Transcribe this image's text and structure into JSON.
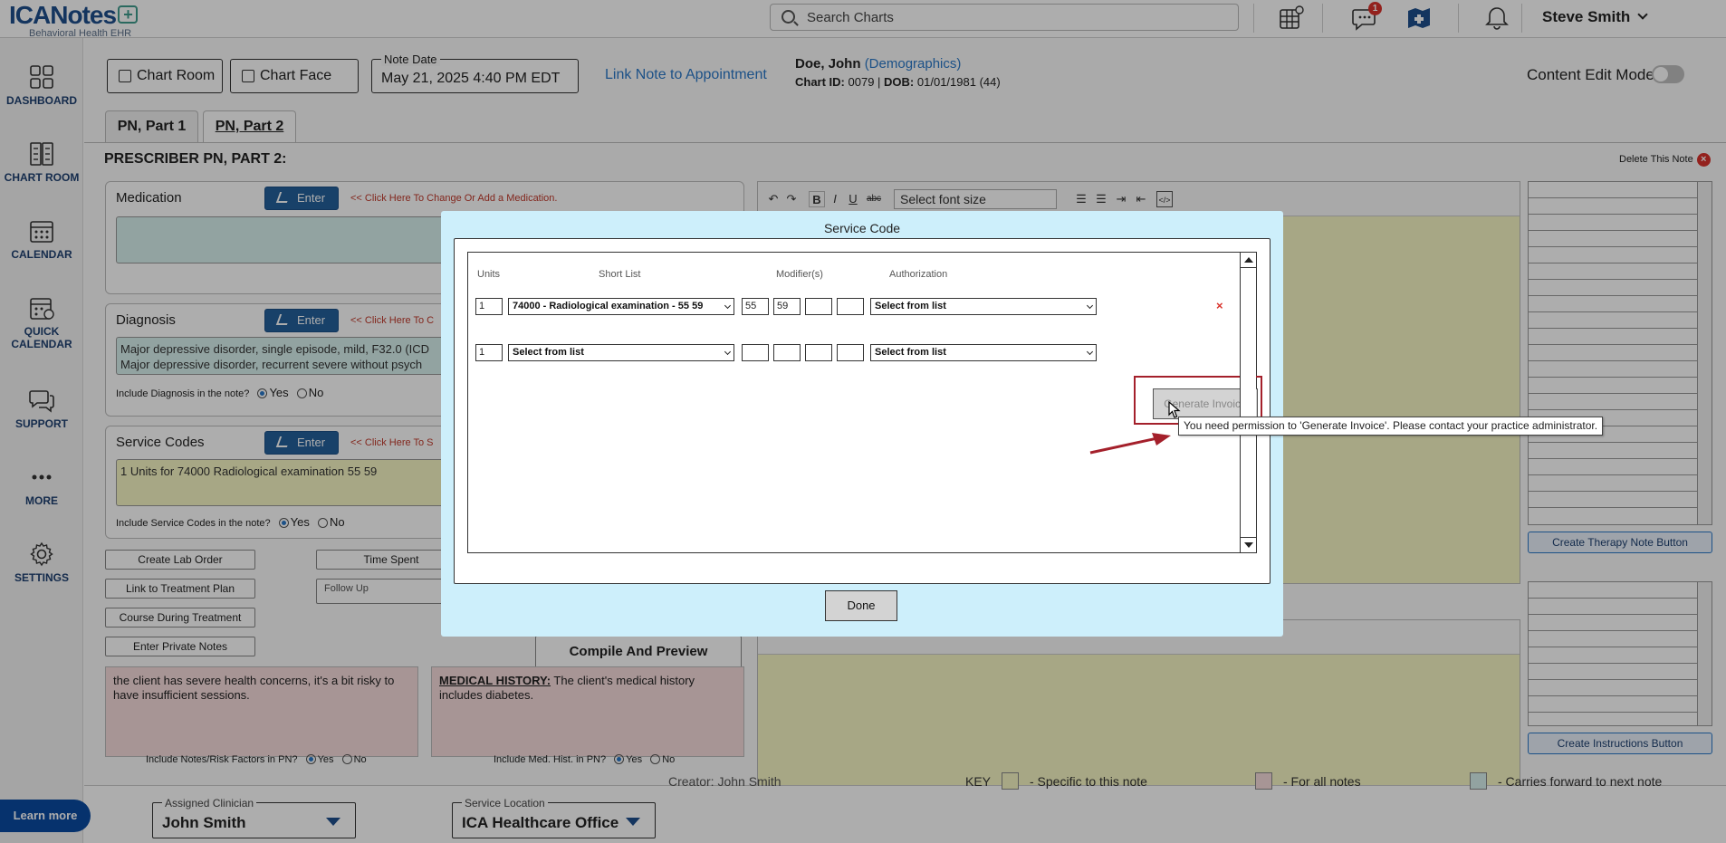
{
  "app": {
    "brand": "ICANotes",
    "tagline": "Behavioral Health EHR"
  },
  "search": {
    "placeholder": "Search Charts"
  },
  "header": {
    "messages_badge": "1",
    "user_name": "Steve Smith",
    "icons": [
      "grid-icon",
      "chat-icon",
      "map-icon",
      "bell-icon"
    ]
  },
  "sidebar": {
    "items": [
      {
        "label": "DASHBOARD",
        "icon": "dashboard-icon"
      },
      {
        "label": "CHART ROOM",
        "icon": "chart-room-icon"
      },
      {
        "label": "CALENDAR",
        "icon": "calendar-icon"
      },
      {
        "label": "QUICK CALENDAR",
        "line1": "QUICK",
        "line2": "CALENDAR",
        "icon": "quick-calendar-icon"
      },
      {
        "label": "SUPPORT",
        "icon": "support-icon"
      },
      {
        "label": "MORE",
        "icon": "more-icon"
      },
      {
        "label": "SETTINGS",
        "icon": "gear-icon"
      }
    ],
    "learn_more": "Learn more"
  },
  "toolbar": {
    "chart_room": "Chart Room",
    "chart_face": "Chart Face",
    "note_date_label": "Note Date",
    "note_date_value": "May 21, 2025 4:40 PM EDT",
    "link_appointment": "Link Note to Appointment",
    "patient_name": "Doe, John",
    "demographics": "(Demographics)",
    "chart_id_label": "Chart ID:",
    "chart_id": "0079",
    "dob_label": "DOB:",
    "dob": "01/01/1981 (44)",
    "content_edit_mode": "Content Edit Mode"
  },
  "tabs": [
    {
      "label": "PN, Part 1",
      "active": false
    },
    {
      "label": "PN, Part 2",
      "active": true
    }
  ],
  "section": {
    "title": "PRESCRIBER PN, PART 2:",
    "delete_note": "Delete This Note"
  },
  "medication": {
    "title": "Medication",
    "enter": "Enter",
    "hint": "<< Click Here To Change Or Add a Medication."
  },
  "diagnosis": {
    "title": "Diagnosis",
    "enter": "Enter",
    "hint": "<< Click Here To C",
    "line1": "Major depressive disorder, single episode, mild, F32.0 (ICD",
    "line2": "Major depressive disorder, recurrent severe without psych",
    "include_label": "Include Diagnosis in the note?",
    "yes": "Yes",
    "no": "No"
  },
  "service_codes": {
    "title": "Service Codes",
    "enter": "Enter",
    "hint": "<< Click Here To S",
    "line1": "1 Units for 74000 Radiological examination 55 59",
    "include_label": "Include Service Codes in the note?",
    "yes": "Yes",
    "no": "No"
  },
  "actions": {
    "create_lab_order": "Create Lab Order",
    "time_spent": "Time Spent",
    "link_treatment_plan": "Link to Treatment Plan",
    "follow_up": "Follow Up",
    "course_during_treatment": "Course During Treatment",
    "enter_private_notes": "Enter Private Notes",
    "compile_preview": "Compile And Preview"
  },
  "notes": {
    "risk_text": "the client has severe health concerns, it's a bit risky to have insufficient sessions.",
    "medhist_heading": "MEDICAL HISTORY:",
    "medhist_text": " The client's medical history includes diabetes.",
    "include_risk": "Include Notes/Risk Factors in PN?",
    "include_medhist": "Include Med. Hist. in PN?",
    "yes": "Yes",
    "no": "No"
  },
  "editor": {
    "font_size_placeholder": "Select font size",
    "bold": "B",
    "italic": "I",
    "underline": "U",
    "strike": "abc"
  },
  "right_panel": {
    "create_therapy": "Create Therapy Note Button",
    "create_instructions": "Create Instructions Button"
  },
  "footer": {
    "assigned_clinician_label": "Assigned Clinician",
    "assigned_clinician": "John Smith",
    "service_location_label": "Service Location",
    "service_location": "ICA Healthcare Office",
    "creator": "Creator: John Smith",
    "key": "KEY",
    "key_specific": "- Specific to this note",
    "key_all": "- For all notes",
    "key_forward": "- Carries forward to next note",
    "colors": {
      "specific": "#f7f7c4",
      "all": "#f6dcdc",
      "forward": "#d8f1ee"
    }
  },
  "modal": {
    "title": "Service Code",
    "headers": {
      "units": "Units",
      "short_list": "Short List",
      "modifiers": "Modifier(s)",
      "authorization": "Authorization"
    },
    "rows": [
      {
        "units": "1",
        "code": "74000 - Radiological examination - 55 59",
        "mod1": "55",
        "mod2": "59",
        "mod3": "",
        "mod4": "",
        "authorization": "Select from list",
        "removable": true
      },
      {
        "units": "1",
        "code": "Select from list",
        "mod1": "",
        "mod2": "",
        "mod3": "",
        "mod4": "",
        "authorization": "Select from list",
        "removable": false
      }
    ],
    "generate_invoice": "Generate Invoice",
    "tooltip": "You need permission to 'Generate Invoice'. Please contact your practice administrator.",
    "done": "Done"
  }
}
